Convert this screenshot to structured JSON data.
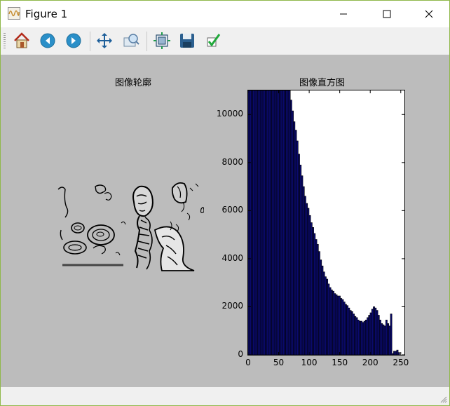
{
  "window": {
    "title": "Figure 1",
    "minimize_icon": "minimize-icon",
    "maximize_icon": "maximize-icon",
    "close_icon": "close-icon"
  },
  "toolbar": {
    "buttons": [
      {
        "name": "home",
        "icon": "home-icon"
      },
      {
        "name": "back",
        "icon": "back-arrow-icon"
      },
      {
        "name": "forward",
        "icon": "forward-arrow-icon"
      },
      {
        "name": "pan",
        "icon": "move-icon"
      },
      {
        "name": "zoom",
        "icon": "zoom-rect-icon"
      },
      {
        "name": "subplots",
        "icon": "subplots-icon"
      },
      {
        "name": "save",
        "icon": "save-icon"
      },
      {
        "name": "edit",
        "icon": "checkmark-icon"
      }
    ]
  },
  "figure": {
    "left_title": "图像轮廓",
    "right_title": "图像直方图"
  },
  "chart_data": {
    "type": "bar",
    "title": "图像直方图",
    "xlabel": "",
    "ylabel": "",
    "xlim": [
      0,
      256
    ],
    "ylim": [
      0,
      11000
    ],
    "xticks": [
      0,
      50,
      100,
      150,
      200,
      250
    ],
    "yticks": [
      0,
      2000,
      4000,
      6000,
      8000,
      10000
    ],
    "bin_width": 2.56,
    "values": [
      11000,
      11000,
      11000,
      11000,
      11000,
      11000,
      11000,
      11000,
      11000,
      11000,
      11000,
      11000,
      11000,
      11000,
      11000,
      11000,
      11000,
      11000,
      11000,
      11000,
      11000,
      11000,
      11000,
      11000,
      11000,
      11000,
      11000,
      10600,
      10150,
      9700,
      9350,
      8900,
      8350,
      7900,
      7450,
      7000,
      6600,
      6300,
      6100,
      5800,
      5500,
      5300,
      5050,
      4800,
      4600,
      4300,
      3950,
      3700,
      3450,
      3250,
      3150,
      2950,
      2800,
      2700,
      2650,
      2550,
      2500,
      2450,
      2450,
      2350,
      2300,
      2200,
      2100,
      2050,
      1950,
      1850,
      1800,
      1700,
      1600,
      1550,
      1450,
      1400,
      1400,
      1350,
      1400,
      1450,
      1550,
      1650,
      1750,
      1900,
      2000,
      1950,
      1850,
      1650,
      1450,
      1300,
      1250,
      1200,
      1450,
      1300,
      1200,
      1700,
      50,
      150,
      150,
      200,
      100,
      0,
      0,
      0
    ]
  }
}
